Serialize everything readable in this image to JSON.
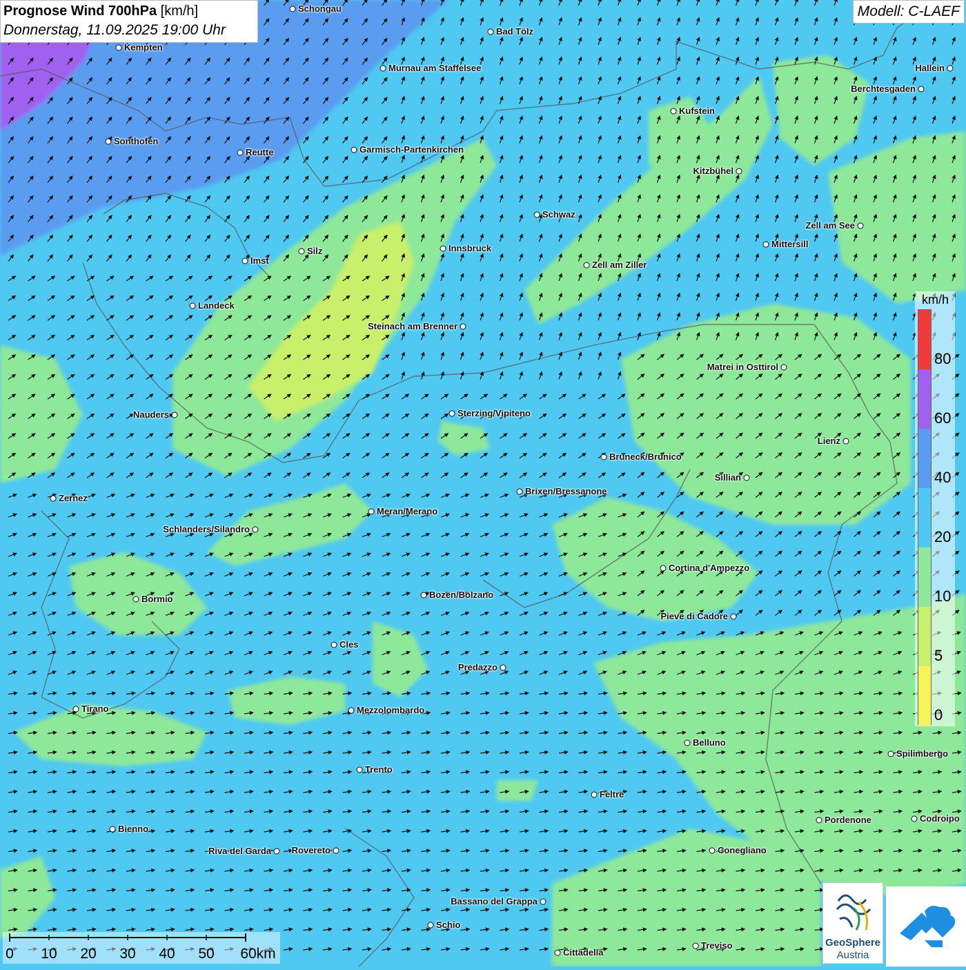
{
  "title": {
    "main": "Prognose Wind 700hPa",
    "unit": "[km/h]",
    "datetime": "Donnerstag, 11.09.2025 19:00 Uhr"
  },
  "model": "Modell: C-LAEF",
  "legend": {
    "unit": "km/h",
    "ticks": [
      "0",
      "5",
      "10",
      "20",
      "40",
      "60",
      "80"
    ],
    "colors": [
      "#f6f45a",
      "#c9f06a",
      "#8ee89a",
      "#4fc8f2",
      "#5a9cf0",
      "#a060f0",
      "#f23a3a"
    ]
  },
  "colors": {
    "field_base": "#4fc8f2",
    "field_weak": "#8ee89a",
    "field_calm": "#c9f06a",
    "field_strong": "#5a9cf0",
    "field_stronger": "#a060f0"
  },
  "cities": [
    {
      "name": "Schongau",
      "side": "right"
    },
    {
      "name": "Bad Tölz",
      "side": "right"
    },
    {
      "name": "Kempten",
      "side": "right"
    },
    {
      "name": "Murnau am Staffelsee",
      "side": "right"
    },
    {
      "name": "Hallein",
      "side": "left"
    },
    {
      "name": "Berchtesgaden",
      "side": "left"
    },
    {
      "name": "Kufstein",
      "side": "right"
    },
    {
      "name": "Sonthofen",
      "side": "right"
    },
    {
      "name": "Reutte",
      "side": "right"
    },
    {
      "name": "Garmisch-Partenkirchen",
      "side": "right"
    },
    {
      "name": "Kitzbühel",
      "side": "left"
    },
    {
      "name": "Schwaz",
      "side": "right"
    },
    {
      "name": "Zell am See",
      "side": "left"
    },
    {
      "name": "Innsbruck",
      "side": "right"
    },
    {
      "name": "Silz",
      "side": "right"
    },
    {
      "name": "Mittersill",
      "side": "right"
    },
    {
      "name": "Imst",
      "side": "right"
    },
    {
      "name": "Zell am Ziller",
      "side": "right"
    },
    {
      "name": "Landeck",
      "side": "right"
    },
    {
      "name": "Steinach am Brenner",
      "side": "left"
    },
    {
      "name": "Matrei in Osttirol",
      "side": "left"
    },
    {
      "name": "Nauders",
      "side": "left"
    },
    {
      "name": "Sterzing/Vipiteno",
      "side": "right"
    },
    {
      "name": "Lienz",
      "side": "left"
    },
    {
      "name": "Bruneck/Brunico",
      "side": "right"
    },
    {
      "name": "Sillian",
      "side": "left"
    },
    {
      "name": "Brixen/Bressanone",
      "side": "right"
    },
    {
      "name": "Zernez",
      "side": "right"
    },
    {
      "name": "Meran/Merano",
      "side": "right"
    },
    {
      "name": "Schlanders/Silandro",
      "side": "left"
    },
    {
      "name": "Cortina d'Ampezzo",
      "side": "right"
    },
    {
      "name": "Bozen/Bolzano",
      "side": "right"
    },
    {
      "name": "Bormio",
      "side": "right"
    },
    {
      "name": "Pieve di Cadore",
      "side": "left"
    },
    {
      "name": "Cles",
      "side": "right"
    },
    {
      "name": "Predazzo",
      "side": "left"
    },
    {
      "name": "Tirano",
      "side": "right"
    },
    {
      "name": "Mezzolombardo",
      "side": "right"
    },
    {
      "name": "Belluno",
      "side": "right"
    },
    {
      "name": "Spilimbergo",
      "side": "right"
    },
    {
      "name": "Trento",
      "side": "right"
    },
    {
      "name": "Feltre",
      "side": "right"
    },
    {
      "name": "Pordenone",
      "side": "right"
    },
    {
      "name": "Codroipo",
      "side": "right"
    },
    {
      "name": "Bienno",
      "side": "right"
    },
    {
      "name": "Riva del Garda",
      "side": "left"
    },
    {
      "name": "Rovereto",
      "side": "left"
    },
    {
      "name": "Conegliano",
      "side": "right"
    },
    {
      "name": "Bassano del Grappa",
      "side": "left"
    },
    {
      "name": "Schio",
      "side": "right"
    },
    {
      "name": "Treviso",
      "side": "right"
    },
    {
      "name": "Cittadella",
      "side": "right"
    }
  ],
  "scale": {
    "labels": [
      "0",
      "10",
      "20",
      "30",
      "40",
      "50",
      "60km"
    ]
  },
  "logo": {
    "name_line1": "GeoSphere",
    "name_line2": "Austria"
  }
}
